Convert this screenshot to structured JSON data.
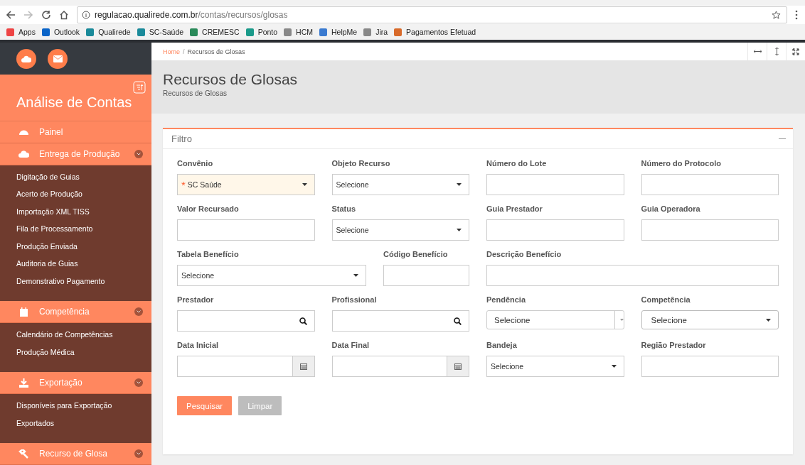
{
  "browser": {
    "url_host": "regulacao.qualirede.com.br",
    "url_path": "/contas/recursos/glosas",
    "bookmarks": [
      "Apps",
      "Outlook",
      "Qualirede",
      "SC-Saúde",
      "CREMESC",
      "Ponto",
      "HCM",
      "HelpMe",
      "Jira",
      "Pagamentos Efetuad"
    ]
  },
  "sidebar": {
    "title": "Análise de Contas",
    "sections": [
      {
        "label": "Painel",
        "expandable": false
      },
      {
        "label": "Entrega de Produção",
        "expandable": true,
        "children": [
          "Digitação de Guias",
          "Acerto de Produção",
          "Importação XML TISS",
          "Fila de Processamento",
          "Produção Enviada",
          "Auditoria de Guias",
          "Demonstrativo Pagamento"
        ]
      },
      {
        "label": "Competência",
        "expandable": true,
        "children": [
          "Calendário de Competências",
          "Produção Médica"
        ]
      },
      {
        "label": "Exportação",
        "expandable": true,
        "children": [
          "Disponíveis para Exportação",
          "Exportados"
        ]
      },
      {
        "label": "Recurso de Glosa",
        "expandable": true
      }
    ]
  },
  "breadcrumb": [
    "Home",
    "/",
    "Recursos de Glosas"
  ],
  "page": {
    "title": "Recursos de Glosas",
    "subtitle": "Recursos de Glosas"
  },
  "filter": {
    "title": "Filtro",
    "rows": [
      [
        {
          "label": "Convênio",
          "kind": "select",
          "value": "SC Saúde",
          "required": true,
          "required_mark": "*"
        },
        {
          "label": "Objeto Recurso",
          "kind": "select",
          "value": "Selecione",
          "required": false
        },
        {
          "label": "Número do Lote",
          "kind": "text"
        },
        {
          "label": "Número do Protocolo",
          "kind": "text"
        }
      ],
      [
        {
          "label": "Valor Recursado",
          "kind": "text"
        },
        {
          "label": "Status",
          "kind": "select",
          "value": "Selecione",
          "required": false
        },
        {
          "label": "Guia Prestador",
          "kind": "text"
        },
        {
          "label": "Guia Operadora",
          "kind": "text"
        }
      ],
      [
        {
          "label": "Tabela Benefício",
          "kind": "select",
          "value": "Selecione",
          "required": false
        },
        {
          "label": "Código Benefício",
          "kind": "text"
        },
        {
          "label": "Descrição Benefício",
          "kind": "text"
        }
      ],
      [
        {
          "label": "Prestador",
          "kind": "search"
        },
        {
          "label": "Profissional",
          "kind": "search"
        },
        {
          "label": "Pendência",
          "kind": "combo",
          "value": "Selecione"
        },
        {
          "label": "Competência",
          "kind": "native",
          "value": "Selecione"
        }
      ],
      [
        {
          "label": "Data Inicial",
          "kind": "date"
        },
        {
          "label": "Data Final",
          "kind": "date"
        },
        {
          "label": "Bandeja",
          "kind": "select",
          "value": "Selecione",
          "required": false
        },
        {
          "label": "Região Prestador",
          "kind": "text"
        }
      ]
    ],
    "buttons": [
      {
        "label": "Pesquisar",
        "disabled": false
      },
      {
        "label": "Limpar",
        "disabled": true
      }
    ]
  }
}
